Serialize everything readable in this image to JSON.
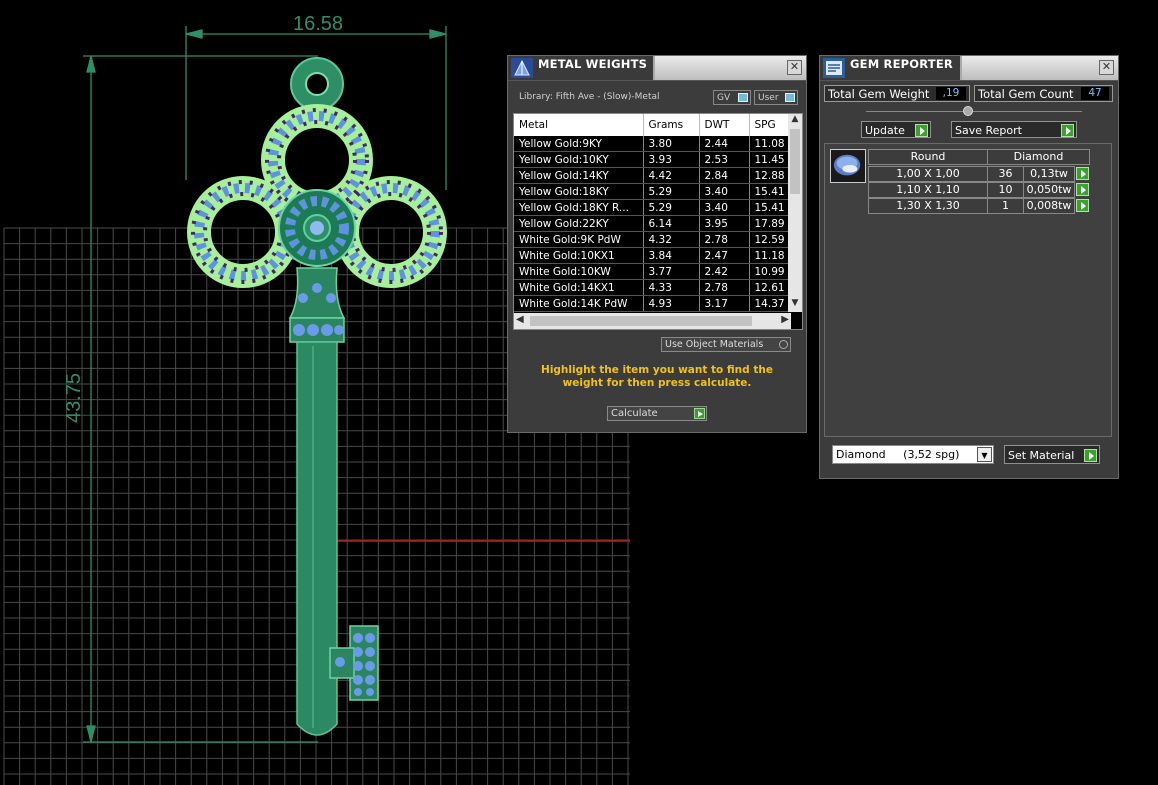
{
  "cad": {
    "dim_width": "16.58",
    "dim_height": "43.75"
  },
  "metal_weights": {
    "title": "METAL WEIGHTS",
    "library_label": "Library: Fifth Ave - (Slow)-Metal",
    "gv_label": "GV",
    "user_label": "User",
    "columns": [
      "Metal",
      "Grams",
      "DWT",
      "SPG"
    ],
    "rows": [
      [
        "Yellow Gold:9KY",
        "3.80",
        "2.44",
        "11.08"
      ],
      [
        "Yellow Gold:10KY",
        "3.93",
        "2.53",
        "11.45"
      ],
      [
        "Yellow Gold:14KY",
        "4.42",
        "2.84",
        "12.88"
      ],
      [
        "Yellow Gold:18KY",
        "5.29",
        "3.40",
        "15.41"
      ],
      [
        "Yellow Gold:18KY R...",
        "5.29",
        "3.40",
        "15.41"
      ],
      [
        "Yellow Gold:22KY",
        "6.14",
        "3.95",
        "17.89"
      ],
      [
        "White Gold:9K PdW",
        "4.32",
        "2.78",
        "12.59"
      ],
      [
        "White Gold:10KX1",
        "3.84",
        "2.47",
        "11.18"
      ],
      [
        "White Gold:10KW",
        "3.77",
        "2.42",
        "10.99"
      ],
      [
        "White Gold:14KX1",
        "4.33",
        "2.78",
        "12.61"
      ],
      [
        "White Gold:14K PdW",
        "4.93",
        "3.17",
        "14.37"
      ]
    ],
    "use_object_materials": "Use Object Materials",
    "hint": "Highlight the item you want to find the weight for then press calculate.",
    "calculate_label": "Calculate"
  },
  "gem_reporter": {
    "title": "GEM REPORTER",
    "total_weight_label": "Total Gem Weight",
    "total_weight_value": ",19",
    "total_count_label": "Total Gem Count",
    "total_count_value": "47",
    "update_label": "Update",
    "save_report_label": "Save Report",
    "shape_header": "Round",
    "material_header": "Diamond",
    "gems": [
      {
        "size": "1,00 X 1,00",
        "count": "36",
        "weight": "0,13tw"
      },
      {
        "size": "1,10 X 1,10",
        "count": "10",
        "weight": "0,050tw"
      },
      {
        "size": "1,30 X 1,30",
        "count": "1",
        "weight": "0,008tw"
      }
    ],
    "material_select": "Diamond     (3,52 spg)",
    "set_material_label": "Set Material"
  }
}
